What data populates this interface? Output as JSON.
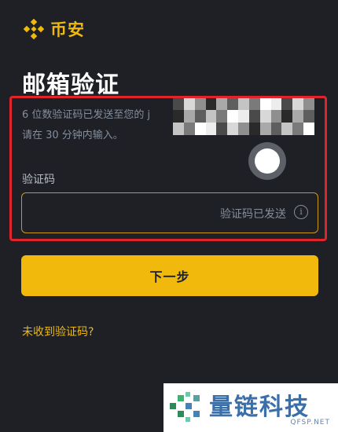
{
  "brand": {
    "name": "币安",
    "logo_icon": "binance-diamond-icon",
    "color": "#f0b90b"
  },
  "page": {
    "title": "邮箱验证"
  },
  "description": {
    "line1": "6 位数验证码已发送至您的 j",
    "line2": "请在 30 分钟内输入。"
  },
  "code_field": {
    "label": "验证码",
    "value": "",
    "hint": "验证码已发送",
    "info_icon": "info-icon",
    "border_color": "#c99a1a"
  },
  "actions": {
    "next_label": "下一步",
    "resend_label": "未收到验证码?"
  },
  "watermark": {
    "text": "量链科技",
    "url": "QFSP.NET",
    "color": "#3a6fa8"
  },
  "colors": {
    "background": "#1e2026",
    "accent": "#f0b90b",
    "highlight_border": "#e0242b",
    "muted_text": "#848e9c"
  }
}
